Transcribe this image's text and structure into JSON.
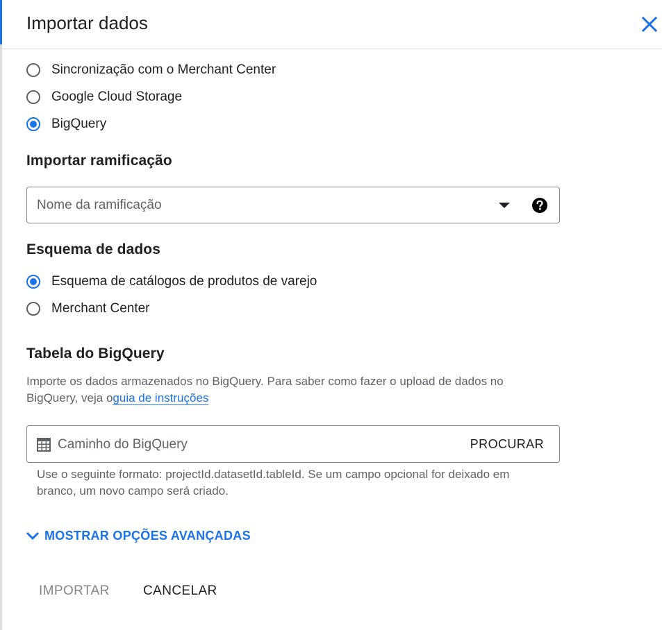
{
  "dialog": {
    "title": "Importar dados"
  },
  "source": {
    "options": [
      {
        "label": "Sincronização com o Merchant Center",
        "selected": false
      },
      {
        "label": "Google Cloud Storage",
        "selected": false
      },
      {
        "label": "BigQuery",
        "selected": true
      }
    ]
  },
  "branch": {
    "section_title": "Importar ramificação",
    "placeholder": "Nome da ramificação"
  },
  "schema": {
    "section_title": "Esquema de dados",
    "options": [
      {
        "label": "Esquema de catálogos de produtos de varejo",
        "selected": true
      },
      {
        "label": "Merchant Center",
        "selected": false
      }
    ]
  },
  "bigquery": {
    "section_title": "Tabela do BigQuery",
    "description": "Importe os dados armazenados no BigQuery. Para saber como fazer o upload de dados no BigQuery, veja o",
    "guide_link": "guia de instruções",
    "path_placeholder": "Caminho do BigQuery",
    "browse_label": "PROCURAR",
    "hint": "Use o seguinte formato: projectId.datasetId.tableId. Se um campo opcional for deixado em branco, um novo campo será criado."
  },
  "advanced": {
    "label": "MOSTRAR OPÇÕES AVANÇADAS"
  },
  "actions": {
    "import_label": "IMPORTAR",
    "cancel_label": "CANCELAR"
  },
  "colors": {
    "accent": "#1a73e8",
    "text": "#202124",
    "muted": "#5f6368",
    "disabled": "#80868b"
  }
}
